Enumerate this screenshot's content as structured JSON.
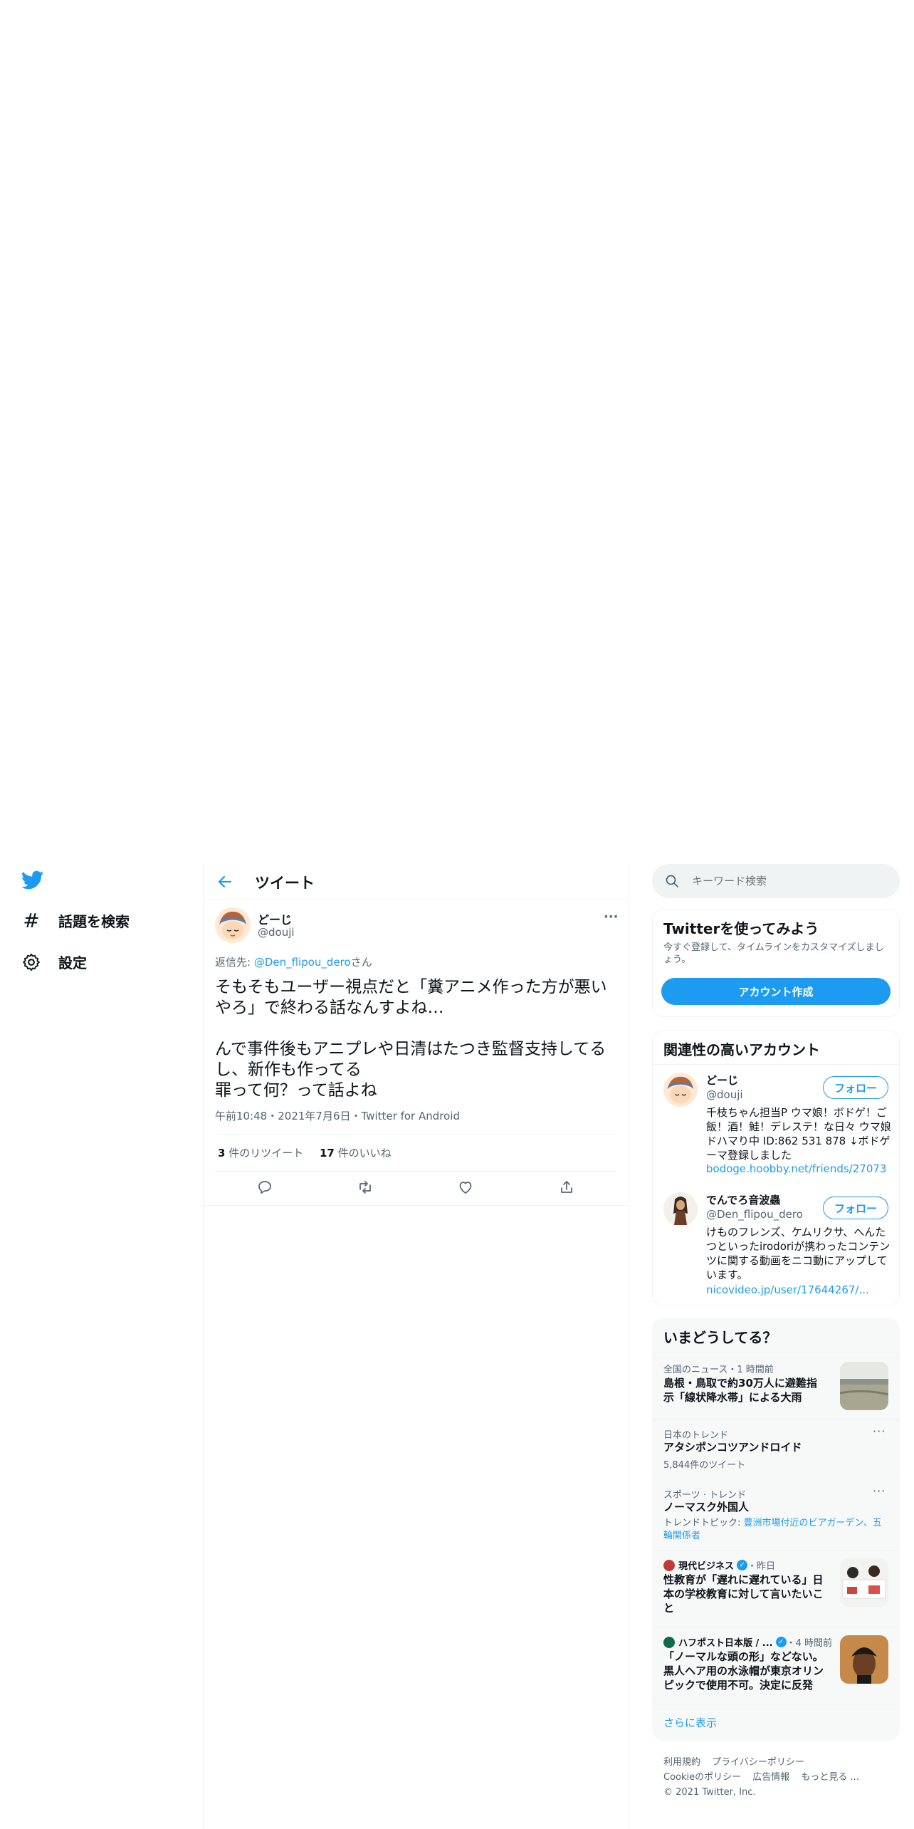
{
  "nav": {
    "explore_label": "話題を検索",
    "settings_label": "設定"
  },
  "header": {
    "title": "ツイート"
  },
  "tweet": {
    "display_name": "どーじ",
    "handle": "@douji",
    "reply_prefix": "返信先: ",
    "reply_to": "@Den_flipou_dero",
    "reply_suffix": "さん",
    "text": "そもそもユーザー視点だと「糞アニメ作った方が悪いやろ」で終わる話なんすよね…\n\nんで事件後もアニプレや日清はたつき監督支持してるし、新作も作ってる\n罪って何？って話よね",
    "time": "午前10:48",
    "date": "2021年7月6日",
    "source": "Twitter for Android",
    "retweet_count": "3",
    "retweet_label": " 件のリツイート",
    "like_count": "17",
    "like_label": " 件のいいね",
    "more_glyph": "···"
  },
  "search": {
    "placeholder": "キーワード検索"
  },
  "signup": {
    "title": "Twitterを使ってみよう",
    "description": "今すぐ登録して、タイムラインをカスタマイズしましょう。",
    "button_label": "アカウント作成"
  },
  "related": {
    "title": "関連性の高いアカウント",
    "accounts": [
      {
        "name": "どーじ",
        "handle": "@douji",
        "follow_label": "フォロー",
        "bio": "千枝ちゃん担当P ウマ娘！ボドゲ！ご飯！酒！鮭！デレステ！な日々 ウマ娘ドハマり中 ID:862 531 878 ↓ボドゲーマ登録しました",
        "link": "bodoge.hoobby.net/friends/27073"
      },
      {
        "name": "でんでろ音波蟲",
        "handle": "@Den_flipou_dero",
        "follow_label": "フォロー",
        "bio": "けものフレンズ、ケムリクサ、へんたつといったirodoriが携わったコンテンツに関する動画をニコ動にアップしています。",
        "link": "nicovideo.jp/user/17644267/..."
      }
    ]
  },
  "trends": {
    "title": "いまどうしてる？",
    "items": [
      {
        "meta": "全国のニュース・1 時間前",
        "title": "島根・鳥取で約30万人に避難指示「線状降水帯」による大雨"
      },
      {
        "meta": "日本のトレンド",
        "title": "アタシポンコツアンドロイド",
        "sub": "5,844件のツイート"
      },
      {
        "meta": "スポーツ · トレンド",
        "title": "ノーマスク外国人",
        "sub_prefix": "トレンドトピック: ",
        "sub_links": "豊洲市場付近のビアガーデン、五輪関係者"
      },
      {
        "source": "現代ビジネス",
        "meta": "・昨日",
        "title": "性教育が「遅れに遅れている」日本の学校教育に対して言いたいこと"
      },
      {
        "source": "ハフポスト日本版 / ...",
        "meta": "・4 時間前",
        "title": "「ノーマルな頭の形」などない。黒人ヘア用の水泳帽が東京オリンピックで使用不可。決定に反発"
      }
    ],
    "show_more": "さらに表示"
  },
  "footer": {
    "terms": "利用規約",
    "privacy": "プライバシーポリシー",
    "cookie": "Cookieのポリシー",
    "ads": "広告情報",
    "more": "もっと見る ...",
    "copyright": "© 2021 Twitter, Inc."
  },
  "colors": {
    "accent": "#1d9bf0",
    "text": "#0f1419",
    "muted": "#536471",
    "border": "#eff3f4",
    "panel_bg": "#f7f9f9"
  }
}
